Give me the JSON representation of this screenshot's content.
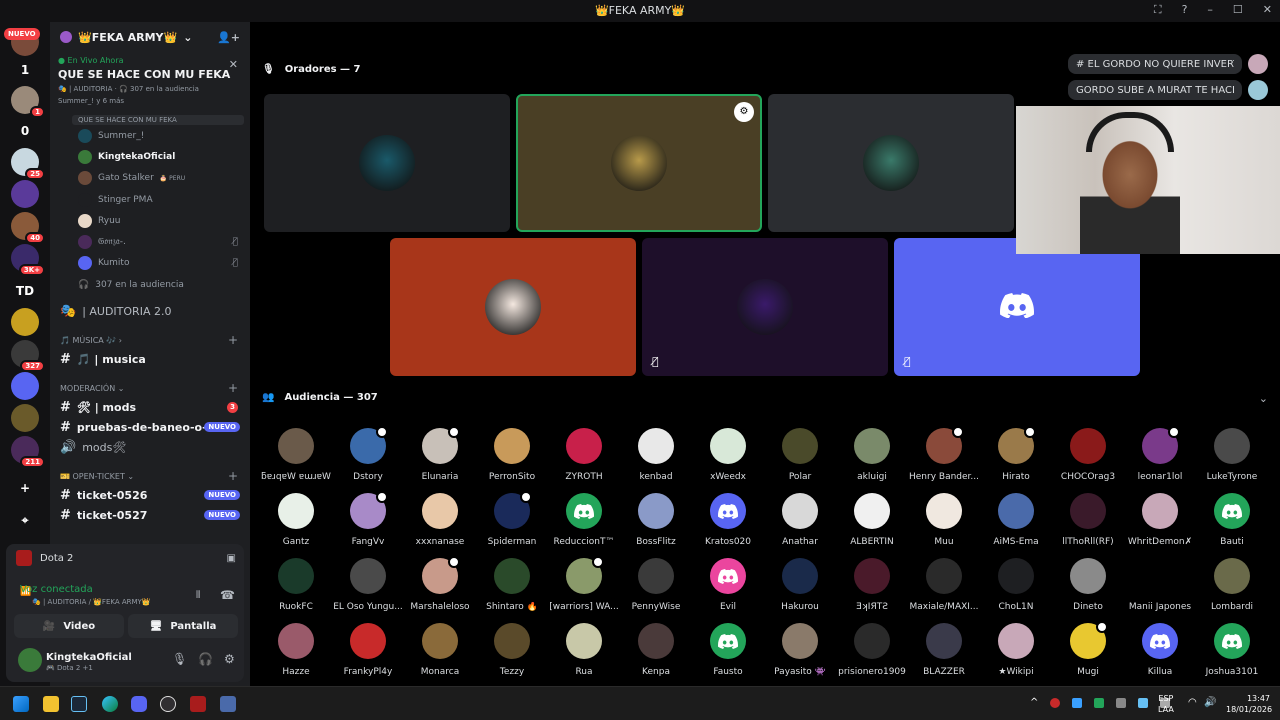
{
  "window": {
    "title": "👑FEKA ARMY👑",
    "controls": [
      "⛶",
      "?",
      "–",
      "☐",
      "✕"
    ]
  },
  "guilds": [
    {
      "label": "",
      "color": "#7a4b3a",
      "badge": "",
      "pill": "NUEVO"
    },
    {
      "label": "1",
      "color": "#121214",
      "badge": ""
    },
    {
      "label": "",
      "color": "#9a8a7a",
      "badge": "1"
    },
    {
      "label": "0",
      "color": "#121214",
      "badge": ""
    },
    {
      "label": "",
      "color": "#c8d8e0",
      "badge": "25"
    },
    {
      "label": "",
      "color": "#5a3a9a",
      "badge": ""
    },
    {
      "label": "",
      "color": "#8a5a3a",
      "badge": "40"
    },
    {
      "label": "",
      "color": "#3a2a6a",
      "badge": "3K+"
    },
    {
      "label": "TD",
      "color": "#121214",
      "badge": ""
    },
    {
      "label": "",
      "color": "#c8a020",
      "badge": ""
    },
    {
      "label": "",
      "color": "#3a3a3a",
      "badge": "327"
    },
    {
      "label": "",
      "color": "#5865f2",
      "badge": ""
    },
    {
      "label": "",
      "color": "#6a5a2a",
      "badge": ""
    },
    {
      "label": "",
      "color": "#4a2a5a",
      "badge": "211"
    },
    {
      "label": "+",
      "color": "#121214",
      "badge": ""
    },
    {
      "label": "⌖",
      "color": "#121214",
      "badge": ""
    }
  ],
  "sidebar": {
    "server_name": "👑FEKA ARMY👑",
    "live_label": "● En Vivo Ahora",
    "live_title": "QUE SE HACE CON MU FEKA",
    "live_sub": "🎭 | AUDITORIA · 🎧 307 en la audiencia",
    "live_sub2": "Summer_! y 6 más",
    "stage_header": "QUE SE HACE CON MU FEKA",
    "voice_users": [
      {
        "name": "Summer_!",
        "color": "#1a4a5a",
        "bright": false,
        "muted": false,
        "extra": ""
      },
      {
        "name": "KingtekaOficial",
        "color": "#3a7a3a",
        "bright": true,
        "muted": false,
        "extra": ""
      },
      {
        "name": "Gato Stalker",
        "color": "#6a4a3a",
        "bright": false,
        "muted": false,
        "extra": "🎂 PERU"
      },
      {
        "name": "Stinger PMA",
        "color": "#1e1f22",
        "bright": false,
        "muted": false,
        "extra": ""
      },
      {
        "name": "Ryuu",
        "color": "#e8d8c8",
        "bright": false,
        "muted": false,
        "extra": ""
      },
      {
        "name": "𝔊𝔬𝔫𝔷𝔞-.",
        "color": "#4a2a5a",
        "bright": false,
        "muted": true,
        "extra": ""
      },
      {
        "name": "Kumito",
        "color": "#5865f2",
        "bright": false,
        "muted": true,
        "extra": ""
      }
    ],
    "audience_count": "307 en la audiencia",
    "channels": [
      {
        "type": "chan",
        "icon": "🎭",
        "label": "| AUDITORIA 2.0",
        "bold": false,
        "badge": "",
        "badgeType": ""
      },
      {
        "type": "cat",
        "label": "🎵 MÚSICA 🎶 ›"
      },
      {
        "type": "chan",
        "icon": "#",
        "label": "🎵 | musica",
        "bold": true,
        "badge": "",
        "badgeType": ""
      },
      {
        "type": "cat",
        "label": "MODERACIÓN ⌄"
      },
      {
        "type": "chan",
        "icon": "#",
        "label": "🛠 | mods",
        "bold": true,
        "badge": "3",
        "badgeType": "r"
      },
      {
        "type": "chan",
        "icon": "#",
        "label": "pruebas-de-baneo-o-t...",
        "bold": true,
        "badge": "NUEVO",
        "badgeType": "n"
      },
      {
        "type": "chan",
        "icon": "🔊",
        "label": "mods🛠",
        "bold": false,
        "badge": "",
        "badgeType": ""
      },
      {
        "type": "cat",
        "label": "🎫 OPEN-TICKET ⌄"
      },
      {
        "type": "chan",
        "icon": "#",
        "label": "ticket-0526",
        "bold": true,
        "badge": "NUEVO",
        "badgeType": "n"
      },
      {
        "type": "chan",
        "icon": "#",
        "label": "ticket-0527",
        "bold": true,
        "badge": "NUEVO",
        "badgeType": "n"
      }
    ]
  },
  "voice_panel": {
    "activity": "Dota 2",
    "status": "Voz conectada",
    "status_sub": "🎭 | AUDITORIA / 👑FEKA ARMY👑",
    "video_label": "Video",
    "screen_label": "Pantalla",
    "user_name": "KingtekaOficial",
    "user_sub": "🎮 Dota 2 +1"
  },
  "stage": {
    "speakers_title": "Oradores — 7",
    "audience_title": "Audiencia — 307",
    "speaker_tiles": [
      {
        "bg": "#1e1f22",
        "av": "#1a5a6a",
        "muted": false,
        "highlight": false,
        "mod": false
      },
      {
        "bg": "#4a3f25",
        "av": "#b89a4a",
        "muted": false,
        "highlight": true,
        "mod": true
      },
      {
        "bg": "#2b2d31",
        "av": "#3a7a6a",
        "muted": false,
        "highlight": false,
        "mod": false
      },
      {
        "bg": "#a8361a",
        "av": "#f4e8e0",
        "muted": false,
        "highlight": false,
        "mod": false
      },
      {
        "bg": "#1e0f2a",
        "av": "#3a1a6a",
        "muted": true,
        "highlight": false,
        "mod": false
      },
      {
        "bg": "#5865f2",
        "av": "#5865f2",
        "muted": true,
        "highlight": false,
        "mod": false,
        "discord": true
      }
    ],
    "chat_pills": [
      "# EL GORDO NO QUIERE INVERT...",
      "GORDO SUBE A MURAT TE HACE..."
    ]
  },
  "audience": [
    {
      "name": "ƃɐɹqɐW ɐɯɹɐW",
      "color": "#6a5a4a",
      "mod": false
    },
    {
      "name": "Dstory",
      "color": "#3a6aaa",
      "mod": true
    },
    {
      "name": "Elunaria",
      "color": "#c8c0b8",
      "mod": true
    },
    {
      "name": "PerronSito",
      "color": "#c89a5a",
      "mod": false
    },
    {
      "name": "ZYROTH",
      "color": "#c8204a",
      "mod": false
    },
    {
      "name": "kenbad",
      "color": "#e8e8e8",
      "mod": false
    },
    {
      "name": "xWeedx",
      "color": "#d8e8d8",
      "mod": false
    },
    {
      "name": "Polar",
      "color": "#4a4a2a",
      "mod": false
    },
    {
      "name": "akluigi",
      "color": "#7a8a6a",
      "mod": false
    },
    {
      "name": "Henry Bander...",
      "color": "#8a4a3a",
      "mod": true
    },
    {
      "name": "Hirato",
      "color": "#9a7a4a",
      "mod": true
    },
    {
      "name": "CHOCOrag3",
      "color": "#8a1a1a",
      "mod": false
    },
    {
      "name": "leonar1lol",
      "color": "#7a3a8a",
      "mod": true
    },
    {
      "name": "LukeTyrone",
      "color": "#4a4a4a",
      "mod": false
    },
    {
      "name": "Gantz",
      "color": "#e8f0e8",
      "mod": false
    },
    {
      "name": "FangVv",
      "color": "#a88ac8",
      "mod": true
    },
    {
      "name": "xxxnanase",
      "color": "#e8c8a8",
      "mod": false
    },
    {
      "name": "Spiderman",
      "color": "#1a2a5a",
      "mod": true
    },
    {
      "name": "ReduccionT™",
      "color": "#23a55a",
      "mod": false,
      "discord": true
    },
    {
      "name": "BossFlitz",
      "color": "#8a9ac8",
      "mod": false
    },
    {
      "name": "Kratos020",
      "color": "#5865f2",
      "mod": false,
      "discord": true
    },
    {
      "name": "Anathar",
      "color": "#d8d8d8",
      "mod": false
    },
    {
      "name": "ALBERTIN",
      "color": "#f0f0f0",
      "mod": false
    },
    {
      "name": "Muu",
      "color": "#f0e8e0",
      "mod": false
    },
    {
      "name": "AiMS-Ema",
      "color": "#4a6aaa",
      "mod": false
    },
    {
      "name": "llThoRll(RF)",
      "color": "#3a1a2a",
      "mod": false
    },
    {
      "name": "WhritDemon✗",
      "color": "#c8a8b8",
      "mod": false
    },
    {
      "name": "Bauti",
      "color": "#23a55a",
      "mod": false,
      "discord": true
    },
    {
      "name": "RuokFC",
      "color": "#1a3a2a",
      "mod": false
    },
    {
      "name": "EL Oso Yungu...",
      "color": "#4a4a4a",
      "mod": false
    },
    {
      "name": "Marshaleloso",
      "color": "#c89a8a",
      "mod": true
    },
    {
      "name": "Shintaro 🔥",
      "color": "#2a4a2a",
      "mod": false
    },
    {
      "name": "[warriors] WA...",
      "color": "#8a9a6a",
      "mod": true
    },
    {
      "name": "PennyWise",
      "color": "#3a3a3a",
      "mod": false
    },
    {
      "name": "Evil",
      "color": "#eb459e",
      "mod": false,
      "discord": true
    },
    {
      "name": "Hakurou",
      "color": "#1a2a4a",
      "mod": false
    },
    {
      "name": "ƎʞIЯTƧ",
      "color": "#4a1a2a",
      "mod": false
    },
    {
      "name": "Maxiale/MAXI...",
      "color": "#2a2a2a",
      "mod": false
    },
    {
      "name": "ChoL1N",
      "color": "#1e1f22",
      "mod": false
    },
    {
      "name": "Dineto",
      "color": "#8a8a8a",
      "mod": false
    },
    {
      "name": "Manii Japones",
      "color": "#000000",
      "mod": false
    },
    {
      "name": "Lombardi",
      "color": "#6a6a4a",
      "mod": false
    },
    {
      "name": "Hazze",
      "color": "#9a5a6a",
      "mod": false
    },
    {
      "name": "FrankyPl4y",
      "color": "#c82a2a",
      "mod": false
    },
    {
      "name": "Monarca",
      "color": "#8a6a3a",
      "mod": false
    },
    {
      "name": "Tezzy",
      "color": "#5a4a2a",
      "mod": false
    },
    {
      "name": "Rua",
      "color": "#c8c8a8",
      "mod": false
    },
    {
      "name": "Kenpa",
      "color": "#4a3a3a",
      "mod": false
    },
    {
      "name": "Fausto",
      "color": "#23a55a",
      "mod": false,
      "discord": true
    },
    {
      "name": "Payasito 👾",
      "color": "#8a7a6a",
      "mod": false
    },
    {
      "name": "prisionero1909",
      "color": "#2a2a2a",
      "mod": false
    },
    {
      "name": "BLAZZER",
      "color": "#3a3a4a",
      "mod": false
    },
    {
      "name": "★Wikipi",
      "color": "#c8a8b8",
      "mod": false
    },
    {
      "name": "Mugi",
      "color": "#e8c830",
      "mod": true
    },
    {
      "name": "Killua",
      "color": "#5865f2",
      "mod": false,
      "discord": true
    },
    {
      "name": "Joshua3101",
      "color": "#23a55a",
      "mod": false,
      "discord": true
    }
  ],
  "taskbar": {
    "lang_top": "ESP",
    "lang_bottom": "LAA",
    "time": "13:47",
    "date": "18/01/2026"
  }
}
